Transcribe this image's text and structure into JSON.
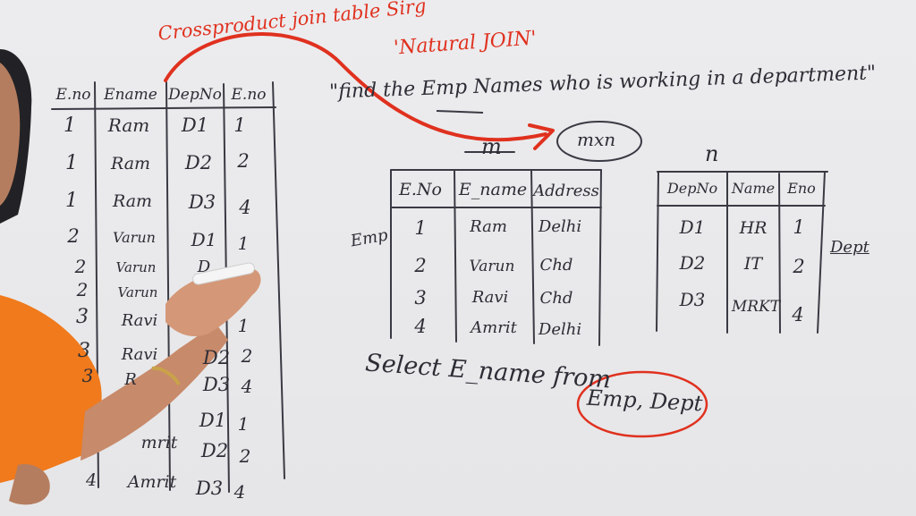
{
  "header": {
    "cross_product_note": "Crossproduct join table Sirg",
    "natural_join": "'Natural JOIN'",
    "query": "\"find the Emp Names who is working in a department\""
  },
  "emp_table": {
    "name": "Emp",
    "size_label": "m",
    "columns": [
      "E.No",
      "E_name",
      "Address"
    ],
    "rows": [
      [
        "1",
        "Ram",
        "Delhi"
      ],
      [
        "2",
        "Varun",
        "Chd"
      ],
      [
        "3",
        "Ravi",
        "Chd"
      ],
      [
        "4",
        "Amrit",
        "Delhi"
      ]
    ]
  },
  "dept_table": {
    "name": "Dept",
    "size_label": "n",
    "columns": [
      "DepNo",
      "Name",
      "Eno"
    ],
    "rows": [
      [
        "D1",
        "HR",
        "1"
      ],
      [
        "D2",
        "IT",
        "2"
      ],
      [
        "D3",
        "MRKT",
        "4"
      ]
    ]
  },
  "product_label": "mxn",
  "cross_product_table": {
    "columns": [
      "E.no",
      "Ename",
      "DepNo",
      "E.no"
    ],
    "rows": [
      [
        "1",
        "Ram",
        "D1",
        "1"
      ],
      [
        "1",
        "Ram",
        "D2",
        "2"
      ],
      [
        "1",
        "Ram",
        "D3",
        "4"
      ],
      [
        "2",
        "Varun",
        "D1",
        "1"
      ],
      [
        "2",
        "Varun",
        "D",
        ""
      ],
      [
        "2",
        "Varun",
        "",
        ""
      ],
      [
        "3",
        "Ravi",
        "",
        "1"
      ],
      [
        "3",
        "Ravi",
        "D2",
        "2"
      ],
      [
        "3",
        "R",
        "D3",
        "4"
      ],
      [
        "",
        "",
        "D1",
        "1"
      ],
      [
        "",
        "mrit",
        "D2",
        "2"
      ],
      [
        "4",
        "Amrit",
        "D3",
        "4"
      ]
    ]
  },
  "sql": {
    "select": "Select E_name from",
    "tables": "Emp, Dept"
  },
  "colors": {
    "board": "#e9e9eb",
    "marker_black": "#2d2d36",
    "marker_red": "#e0311f",
    "shirt": "#f07a1c",
    "skin": "#c78a6a"
  }
}
